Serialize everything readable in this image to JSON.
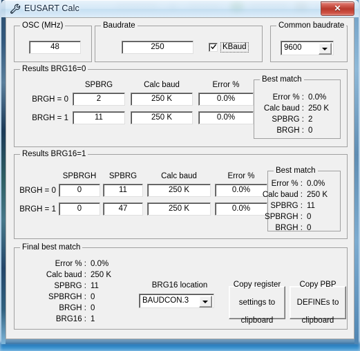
{
  "window": {
    "title": "EUSART Calc",
    "title_icon": "wrench-icon",
    "close_label": "✕"
  },
  "osc_group": {
    "legend": "OSC (MHz)",
    "value": "48"
  },
  "baudrate_group": {
    "legend": "Baudrate",
    "value": "250",
    "kbaud_label": "KBaud",
    "kbaud_checked": true
  },
  "common_baudrate_group": {
    "legend": "Common baudrate",
    "selected": "9600"
  },
  "results_brg16_0": {
    "legend": "Results BRG16=0",
    "headers": [
      "SPBRG",
      "Calc baud",
      "Error %"
    ],
    "row_labels": [
      "BRGH = 0",
      "BRGH = 1"
    ],
    "rows": [
      [
        "2",
        "250 K",
        "0.0%"
      ],
      [
        "11",
        "250 K",
        "0.0%"
      ]
    ],
    "best_match": {
      "legend": "Best match",
      "labels": [
        "Error % :",
        "Calc baud :",
        "SPBRG :",
        "BRGH :"
      ],
      "values": [
        "0.0%",
        "250 K",
        "2",
        "0"
      ]
    }
  },
  "results_brg16_1": {
    "legend": "Results BRG16=1",
    "headers": [
      "SPBRGH",
      "SPBRG",
      "Calc baud",
      "Error %"
    ],
    "row_labels": [
      "BRGH = 0",
      "BRGH = 1"
    ],
    "rows": [
      [
        "0",
        "11",
        "250 K",
        "0.0%"
      ],
      [
        "0",
        "47",
        "250 K",
        "0.0%"
      ]
    ],
    "best_match": {
      "legend": "Best match",
      "labels": [
        "Error % :",
        "Calc baud :",
        "SPBRG :",
        "SPBRGH :",
        "BRGH :"
      ],
      "values": [
        "0.0%",
        "250 K",
        "11",
        "0",
        "0"
      ]
    }
  },
  "final_best_match": {
    "legend": "Final best match",
    "labels": [
      "Error % :",
      "Calc baud :",
      "SPBRG :",
      "SPBRGH :",
      "BRGH :",
      "BRG16 :"
    ],
    "values": [
      "0.0%",
      "250 K",
      "11",
      "0",
      "0",
      "1"
    ],
    "brg16_location_label": "BRG16 location",
    "brg16_location_selected": "BAUDCON.3",
    "copy_register_button": [
      "Copy register",
      "settings to",
      "clipboard"
    ],
    "copy_pbp_button": [
      "Copy PBP",
      "DEFINEs to",
      "clipboard"
    ]
  },
  "colors": {
    "dialog_face": "#f0f0f0",
    "field_bg": "#ffffff",
    "close_red": "#b93a2d",
    "group_border": "#a0a0a0"
  }
}
